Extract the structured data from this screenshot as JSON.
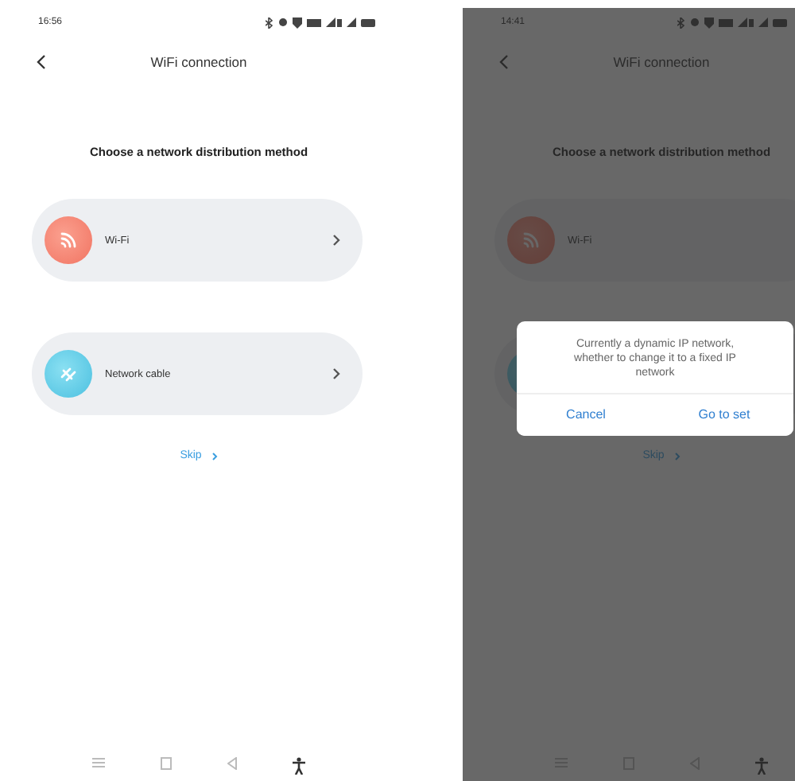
{
  "screens": [
    {
      "status_bar": {
        "time": "16:56"
      },
      "title": "WiFi connection",
      "heading": "Choose a network distribution method",
      "options": [
        {
          "kind": "wifi",
          "label": "Wi-Fi"
        },
        {
          "kind": "cable",
          "label": "Network cable"
        }
      ],
      "skip": "Skip",
      "dimmed": false
    },
    {
      "status_bar": {
        "time": "14:41"
      },
      "title": "WiFi connection",
      "heading": "Choose a network distribution method",
      "options": [
        {
          "kind": "wifi",
          "label": "Wi-Fi"
        },
        {
          "kind": "cable"
        }
      ],
      "skip": "Skip",
      "dimmed": true,
      "dialog": {
        "message": "Currently a dynamic IP network, whether to change it to a fixed IP network",
        "buttons": [
          "Cancel",
          "Go to set"
        ]
      }
    }
  ]
}
